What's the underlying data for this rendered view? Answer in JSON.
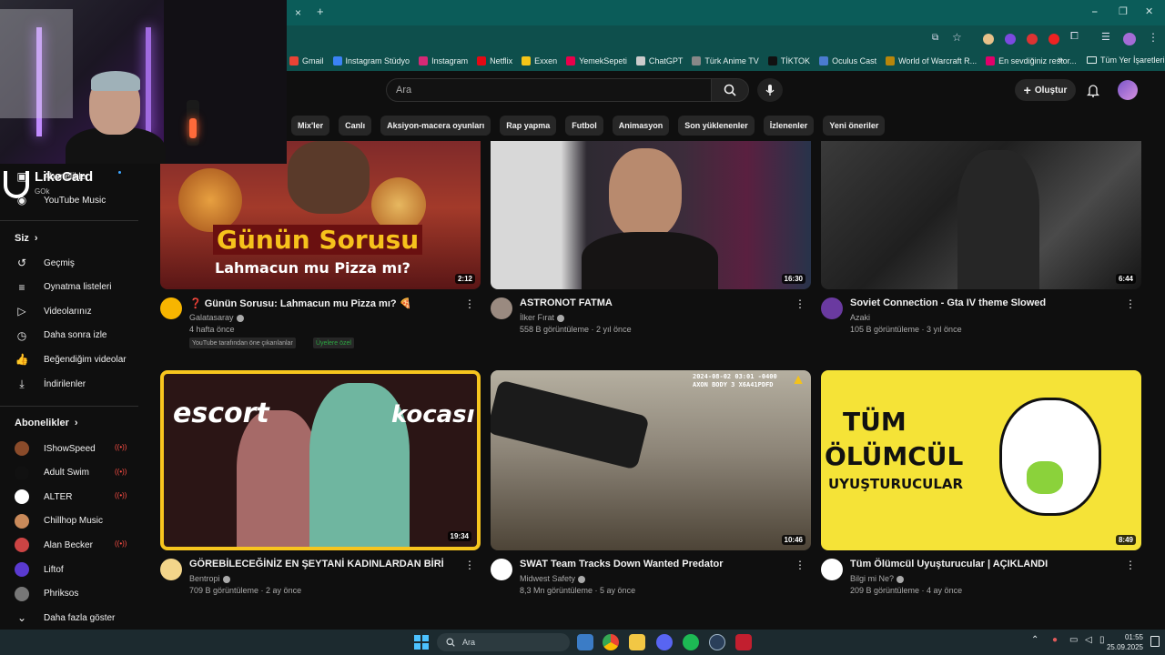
{
  "browser": {
    "new_tab": "+",
    "bookmarks": [
      {
        "label": "Gmail",
        "color": "#ea4335"
      },
      {
        "label": "Instagram Stüdyo",
        "color": "#3b82f6"
      },
      {
        "label": "Instagram",
        "color": "#d62976"
      },
      {
        "label": "Netflix",
        "color": "#e50914"
      },
      {
        "label": "Exxen",
        "color": "#f5c518"
      },
      {
        "label": "YemekSepeti",
        "color": "#ea004b"
      },
      {
        "label": "ChatGPT",
        "color": "#cccccc"
      },
      {
        "label": "Türk Anime TV",
        "color": "#888888"
      },
      {
        "label": "TİKTOK",
        "color": "#111111"
      },
      {
        "label": "Oculus Cast",
        "color": "#4a7bd0"
      },
      {
        "label": "World of Warcraft R...",
        "color": "#b8860b"
      },
      {
        "label": "En sevdiğiniz restor...",
        "color": "#e0006a"
      }
    ],
    "bookmarks_more": "»",
    "all_bookmarks": "Tüm Yer İşaretleri"
  },
  "overlay": {
    "logo_text": "LikeCard",
    "logo_sub": "GOk"
  },
  "masthead": {
    "search_placeholder": "Ara",
    "create_label": "Oluştur"
  },
  "chips": [
    "Mix'ler",
    "Canlı",
    "Aksiyon-macera oyunları",
    "Rap yapma",
    "Futbol",
    "Animasyon",
    "Son yüklenenler",
    "İzlenenler",
    "Yeni öneriler"
  ],
  "sidebar": {
    "top_items": [
      "Abonelikler",
      "YouTube Music"
    ],
    "you_header": "Siz",
    "you_items": [
      {
        "label": "Geçmiş",
        "icon": "history-icon"
      },
      {
        "label": "Oynatma listeleri",
        "icon": "playlist-icon"
      },
      {
        "label": "Videolarınız",
        "icon": "your-videos-icon"
      },
      {
        "label": "Daha sonra izle",
        "icon": "watch-later-icon"
      },
      {
        "label": "Beğendiğim videolar",
        "icon": "like-icon"
      },
      {
        "label": "İndirilenler",
        "icon": "download-icon"
      }
    ],
    "subs_header": "Abonelikler",
    "subs": [
      {
        "label": "IShowSpeed",
        "color": "#8a4b2a",
        "live": true
      },
      {
        "label": "Adult Swim",
        "color": "#111111",
        "live": true
      },
      {
        "label": "ALTER",
        "color": "#ffffff",
        "live": true
      },
      {
        "label": "Chillhop Music",
        "color": "#c98a5a",
        "live": false
      },
      {
        "label": "Alan Becker",
        "color": "#c44",
        "live": true
      },
      {
        "label": "Liftof",
        "color": "#5a3ad0",
        "live": false
      },
      {
        "label": "Phriksos",
        "color": "#777777",
        "live": false
      }
    ],
    "show_more": "Daha fazla göster"
  },
  "videos": [
    {
      "title": "❓ Günün Sorusu: Lahmacun mu Pizza mı? 🍕",
      "channel": "Galatasaray",
      "stats": "4 hafta önce",
      "duration": "2:12",
      "thumb_text_1": "Günün Sorusu",
      "thumb_text_2": "Lahmacun mu Pizza mı?",
      "badges": [
        "YouTube tarafından öne çıkarılanlar",
        "Üyelere özel"
      ],
      "channel_color": "#f7b500"
    },
    {
      "title": "ASTRONOT FATMA",
      "channel": "İlker Fırat",
      "stats": "558 B görüntüleme · 2 yıl önce",
      "duration": "16:30",
      "channel_color": "#9a8a80"
    },
    {
      "title": "Soviet Connection - Gta IV theme Slowed",
      "channel": "Azaki",
      "stats": "105 B görüntüleme · 3 yıl önce",
      "duration": "6:44",
      "channel_color": "#6a3aa0"
    },
    {
      "title": "GÖREBİLECEĞİNİZ EN ŞEYTANİ KADINLARDAN BİRİ",
      "channel": "Bentropi",
      "stats": "709 B görüntüleme · 2 ay önce",
      "duration": "19:34",
      "thumb_text_1": "escort",
      "thumb_text_2": "kocası",
      "channel_color": "#f3d58a"
    },
    {
      "title": "SWAT Team Tracks Down Wanted Predator",
      "channel": "Midwest Safety",
      "stats": "8,3 Mn görüntüleme · 5 ay önce",
      "duration": "10:46",
      "thumb_text_1": "2024-08-02 03:01 -0400",
      "thumb_text_2": "AXON BODY 3 X6A41PDFD",
      "channel_color": "#ffffff"
    },
    {
      "title": "Tüm Ölümcül Uyuşturucular | AÇIKLANDI",
      "channel": "Bilgi mi Ne?",
      "stats": "209 B görüntüleme · 4 ay önce",
      "duration": "8:49",
      "thumb_text_1": "TÜM",
      "thumb_text_2": "ÖLÜMCÜL",
      "thumb_text_3": "UYUŞTURUCULAR",
      "channel_color": "#ffffff"
    }
  ],
  "taskbar": {
    "search_placeholder": "Ara",
    "time": "01:55",
    "date": "25.09.2025"
  }
}
